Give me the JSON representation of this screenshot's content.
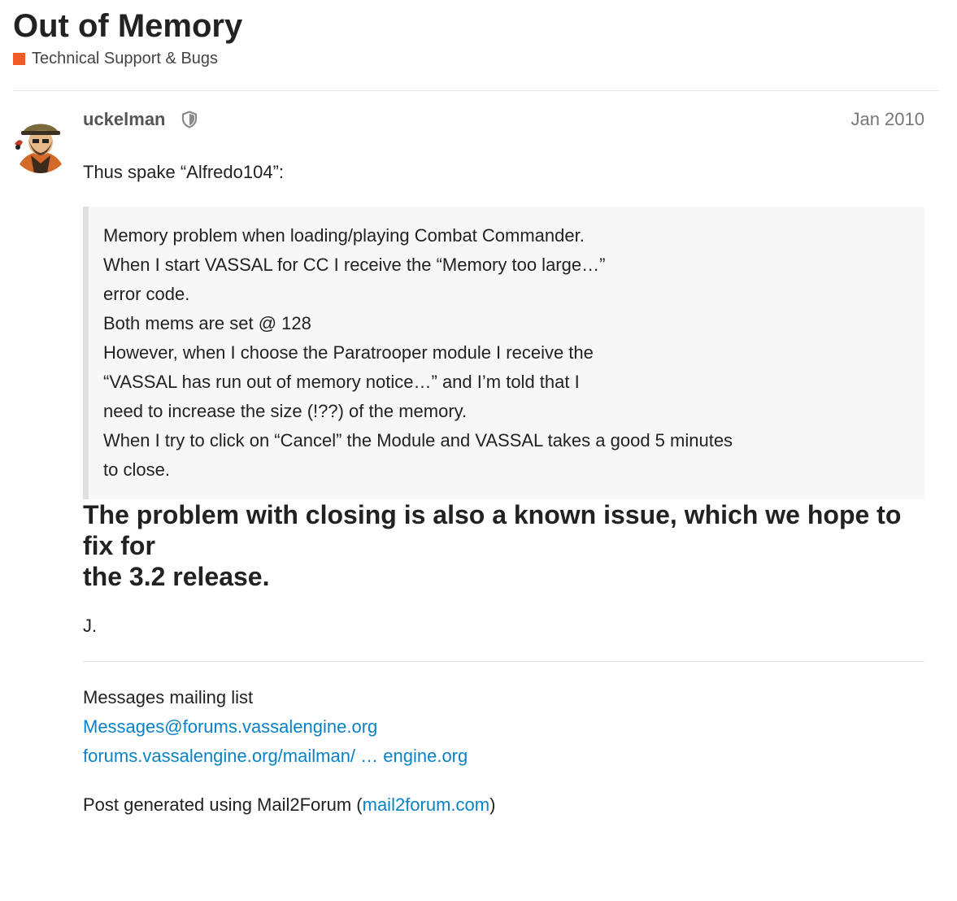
{
  "topic": {
    "title": "Out of Memory",
    "category": {
      "label": "Technical Support & Bugs",
      "color": "#f15a28"
    }
  },
  "post": {
    "username": "uckelman",
    "badge_icon": "shield-icon",
    "date": "Jan 2010",
    "intro": "Thus spake “Alfredo104”:",
    "quote": {
      "lines_1": [
        "Memory problem when loading/playing Combat Commander.",
        "When I start VASSAL for CC I receive the “Memory too large…”",
        "error code.",
        "Both mems are set @ 128"
      ],
      "lines_2": [
        "However, when I choose the Paratrooper module I receive the",
        "“VASSAL has run out of memory notice…” and I’m told that I",
        "need to increase the size (!??) of the memory."
      ],
      "lines_3": [
        "When I try to click on “Cancel” the Module and VASSAL takes a good 5 minutes",
        "to close."
      ]
    },
    "emphasis": [
      "The problem with closing is also a known issue, which we hope to fix for",
      "the 3.2 release."
    ],
    "signature": "J.",
    "footer": {
      "list_label": "Messages mailing list",
      "email_link": "Messages@forums.vassalengine.org",
      "mailman_link": "forums.vassalengine.org/mailman/ … engine.org",
      "generated_prefix": "Post generated using Mail2Forum (",
      "generated_link": "mail2forum.com",
      "generated_suffix": ")"
    }
  }
}
